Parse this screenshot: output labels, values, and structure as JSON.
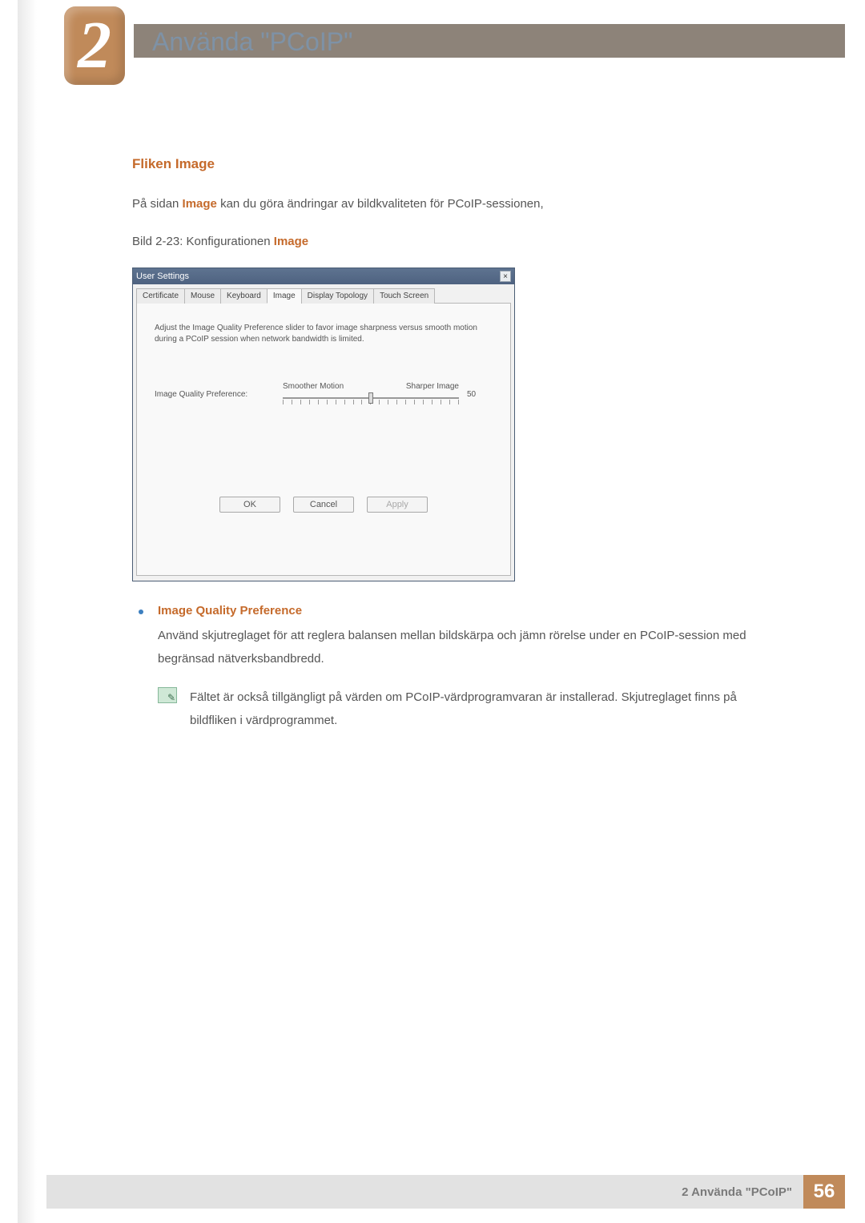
{
  "chapter": {
    "number": "2",
    "title": "Använda \"PCoIP\""
  },
  "section": {
    "title": "Fliken Image"
  },
  "intro": {
    "pretext": "På sidan ",
    "bold": "Image",
    "posttext": " kan du göra ändringar av bildkvaliteten för PCoIP-sessionen,"
  },
  "figure_caption": {
    "pretext": "Bild 2-23: Konfigurationen ",
    "bold": "Image"
  },
  "dialog": {
    "title": "User Settings",
    "tabs": [
      "Certificate",
      "Mouse",
      "Keyboard",
      "Image",
      "Display Topology",
      "Touch Screen"
    ],
    "active_tab_index": 3,
    "help_text": "Adjust the Image Quality Preference slider to favor image sharpness versus smooth motion during a PCoIP session when network bandwidth is limited.",
    "slider_label": "Image Quality Preference:",
    "slider_left": "Smoother Motion",
    "slider_right": "Sharper Image",
    "slider_value": "50",
    "buttons": {
      "ok": "OK",
      "cancel": "Cancel",
      "apply": "Apply"
    }
  },
  "bullet": {
    "title": "Image Quality Preference",
    "text": "Använd skjutreglaget för att reglera balansen mellan bildskärpa och jämn rörelse under en PCoIP-session med begränsad nätverksbandbredd."
  },
  "note": {
    "text": "Fältet är också tillgängligt på värden om PCoIP-värdprogramvaran är installerad. Skjutreglaget finns på bildfliken i värdprogrammet."
  },
  "footer": {
    "text": "2 Använda \"PCoIP\"",
    "page": "56"
  }
}
